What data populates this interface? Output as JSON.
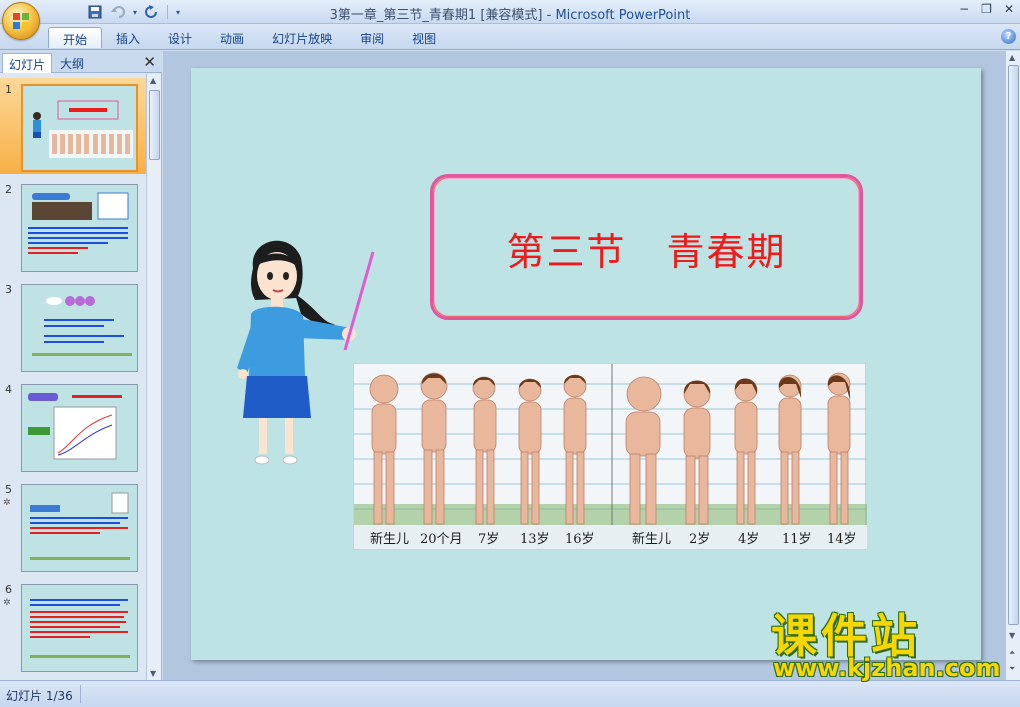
{
  "window": {
    "title_doc": "3第一章_第三节_青春期1 [兼容模式]",
    "title_sep": " - ",
    "title_app": "Microsoft PowerPoint",
    "minimize": "−",
    "restore": "❐",
    "close": "✕"
  },
  "ribbon": {
    "tabs": [
      "开始",
      "插入",
      "设计",
      "动画",
      "幻灯片放映",
      "审阅",
      "视图"
    ],
    "active_tab": "开始",
    "help": "?"
  },
  "left_pane": {
    "tab_slides": "幻灯片",
    "tab_outline": "大纲",
    "close": "✕",
    "thumbnails": [
      {
        "num": "1",
        "selected": true,
        "star": ""
      },
      {
        "num": "2",
        "selected": false,
        "star": ""
      },
      {
        "num": "3",
        "selected": false,
        "star": ""
      },
      {
        "num": "4",
        "selected": false,
        "star": ""
      },
      {
        "num": "5",
        "selected": false,
        "star": "✲"
      },
      {
        "num": "6",
        "selected": false,
        "star": "✲"
      }
    ]
  },
  "slide": {
    "title": "第三节　青春期",
    "growth_labels": [
      "新生儿",
      "20个月",
      "7岁",
      "13岁",
      "16岁",
      "新生儿",
      "2岁",
      "4岁",
      "11岁",
      "14岁"
    ]
  },
  "status": {
    "slide_counter": "幻灯片 1/36"
  },
  "watermark": {
    "brand": "课件站",
    "url": "www.kjzhan.com"
  },
  "colors": {
    "slide_bg": "#bde3e4",
    "title_red": "#ee1b1b",
    "frame_pink": "#e0559d",
    "ribbon_blue": "#15428b"
  }
}
